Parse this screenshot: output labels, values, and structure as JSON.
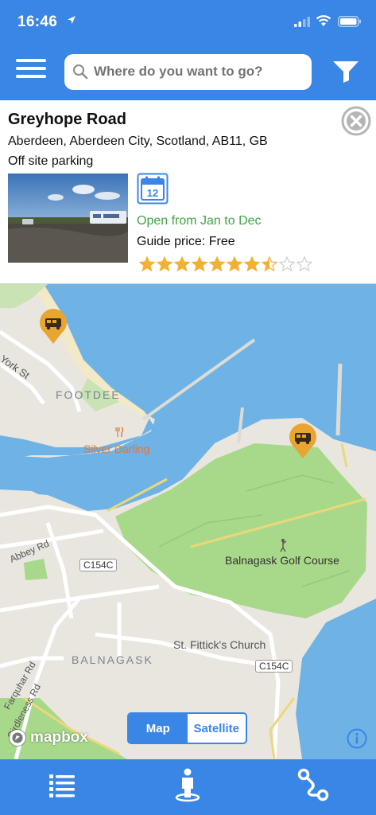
{
  "status_bar": {
    "time": "16:46"
  },
  "search": {
    "placeholder": "Where do you want to go?"
  },
  "card": {
    "title": "Greyhope Road",
    "address": "Aberdeen, Aberdeen City, Scotland, AB11, GB",
    "type": "Off site parking",
    "calendar_day": "12",
    "open_text": "Open from Jan to Dec",
    "price_text": "Guide price: Free",
    "rating": 7.5,
    "rating_max": 10
  },
  "map": {
    "labels": {
      "footdee": "FOOTDEE",
      "york_st": "York St",
      "silver_darling": "Silver Darling",
      "abbey_rd": "Abbey Rd",
      "road_c154c_a": "C154C",
      "golf_course": "Balnagask Golf Course",
      "church": "St. Fittick's Church",
      "balnagask": "BALNAGASK",
      "road_c154c_b": "C154C",
      "farquhar_rd": "Farquhar Rd",
      "girdleness_rd": "Girdleness Rd"
    },
    "toggle": {
      "map": "Map",
      "satellite": "Satellite",
      "selected": "Map"
    },
    "attribution": "mapbox"
  },
  "icons": {
    "menu": "hamburger-icon",
    "filter": "filter-funnel-icon",
    "search": "search-icon",
    "close": "close-circle-icon",
    "calendar": "calendar-icon",
    "pin": "campervan-pin-icon",
    "list": "list-icon",
    "person": "person-location-icon",
    "route": "route-icon",
    "info": "info-icon"
  },
  "colors": {
    "brand_blue": "#3a86e6",
    "open_green": "#3fa640",
    "pin_orange": "#e8a531",
    "star": "#f2b134",
    "water": "#6fb2e5",
    "park": "#a8d98a",
    "land": "#e9e6e0"
  }
}
